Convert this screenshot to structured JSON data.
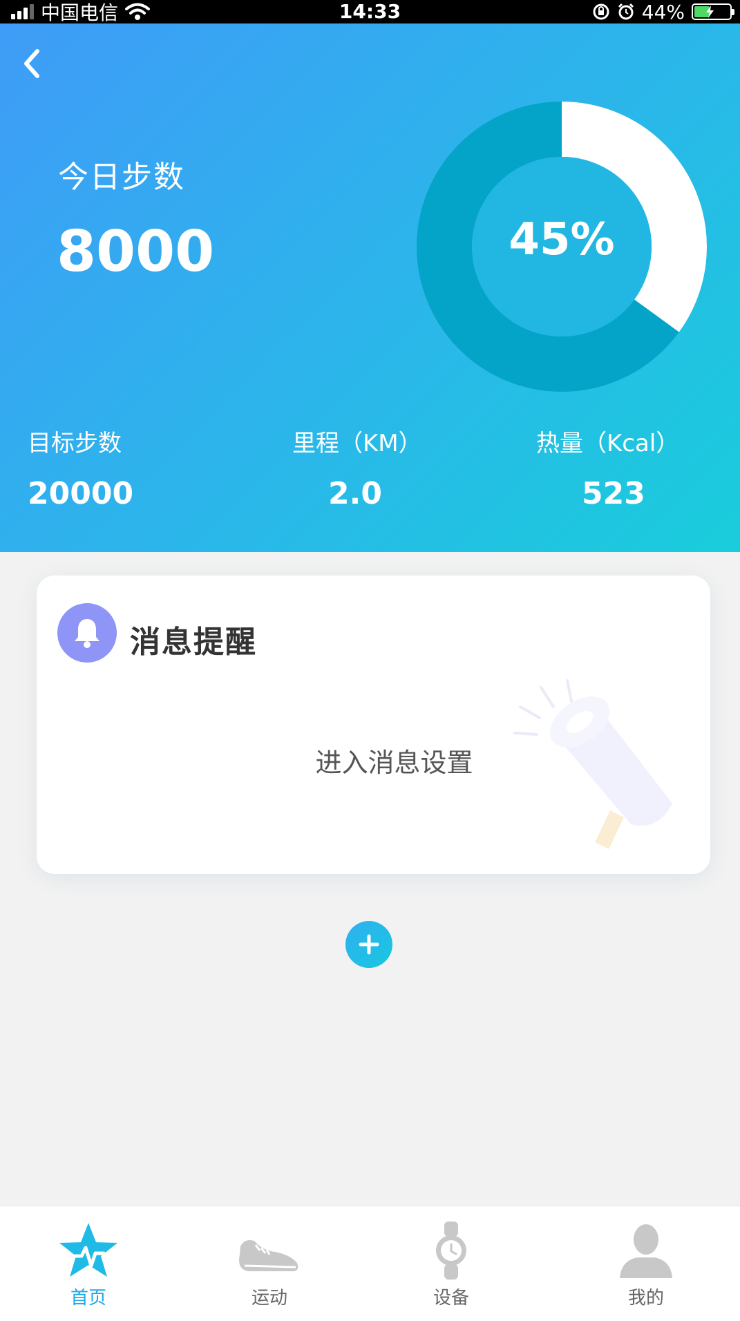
{
  "status_bar": {
    "carrier": "中国电信",
    "time": "14:33",
    "battery": "44%",
    "battery_level": 0.44
  },
  "header": {
    "back_icon": "chevron-left-icon",
    "title": "今日步数",
    "steps": "8000",
    "progress_label": "45%",
    "progress": 0.35,
    "colors": {
      "gradient_start": "#3f9cf7",
      "gradient_end": "#19cddb",
      "ring_track": "#04a3c8",
      "ring_fill": "#ffffff",
      "ring_center": "#22b7e3"
    }
  },
  "stats": [
    {
      "label": "目标步数",
      "value": "20000"
    },
    {
      "label": "里程（KM）",
      "value": "2.0"
    },
    {
      "label": "热量（Kcal）",
      "value": "523"
    }
  ],
  "message_card": {
    "icon": "bell-icon",
    "title": "消息提醒",
    "link": "进入消息设置",
    "illustration": "megaphone-icon",
    "icon_color": "#8f94f7"
  },
  "add_button": {
    "icon": "plus-icon"
  },
  "tabbar": {
    "active_color": "#1aa6e8",
    "items": [
      {
        "label": "首页",
        "icon": "star-pulse-icon"
      },
      {
        "label": "运动",
        "icon": "sneaker-icon"
      },
      {
        "label": "设备",
        "icon": "watch-icon"
      },
      {
        "label": "我的",
        "icon": "user-icon"
      }
    ]
  }
}
